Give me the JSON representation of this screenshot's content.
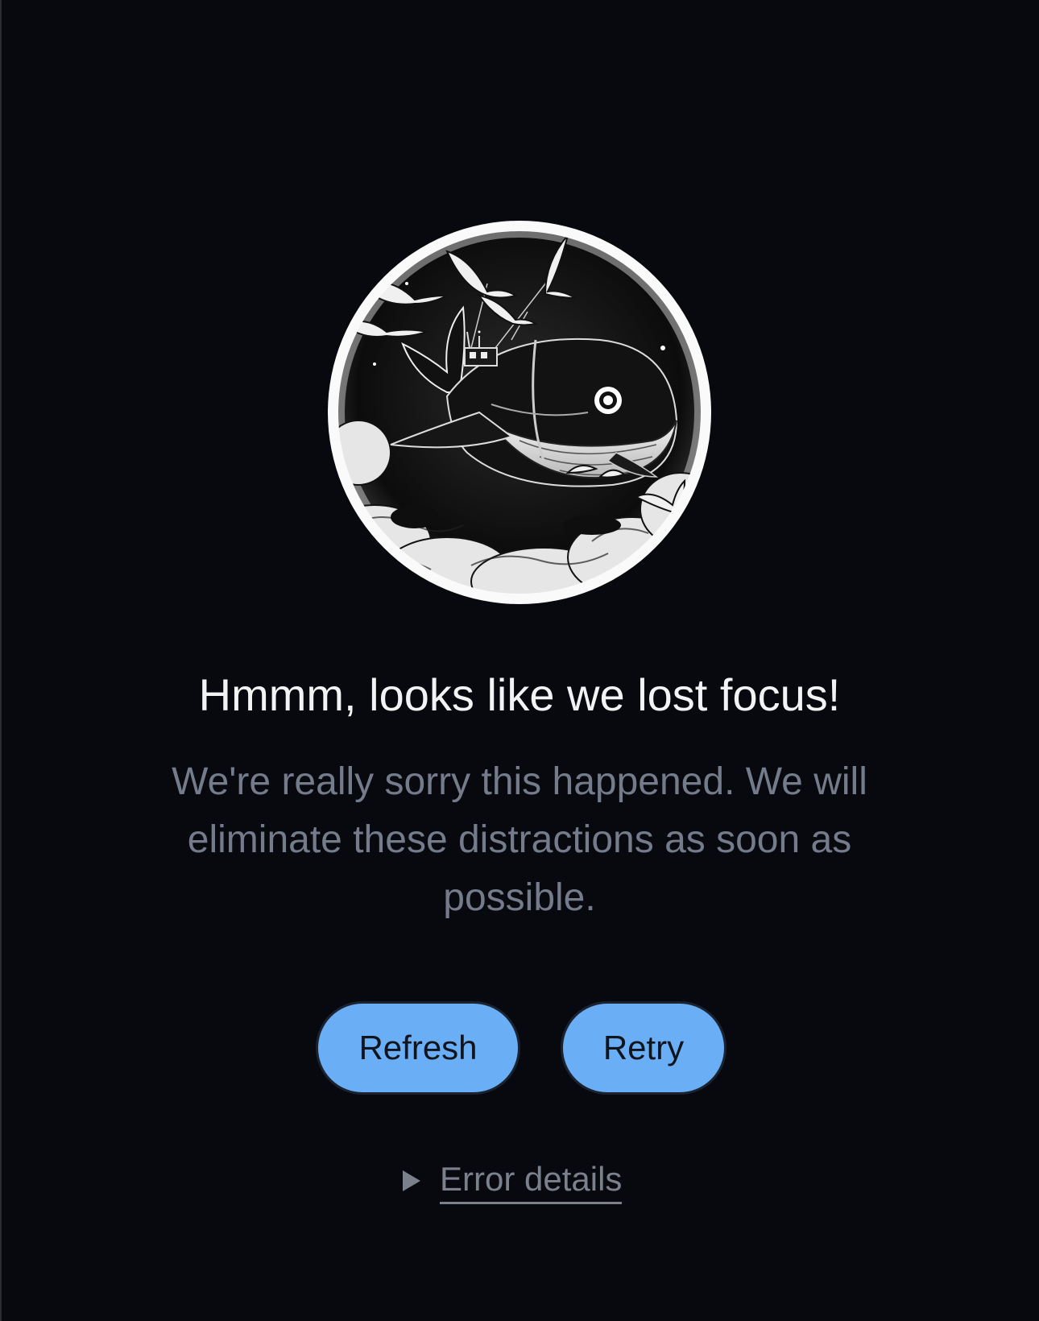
{
  "error_page": {
    "title": "Hmmm, looks like we lost focus!",
    "message": "We're really sorry this happened. We will eliminate these distractions as soon as possible.",
    "illustration": "flying-whale-illustration"
  },
  "actions": {
    "refresh_label": "Refresh",
    "retry_label": "Retry"
  },
  "details": {
    "label": "Error details",
    "expand_icon": "triangle-right-icon"
  },
  "colors": {
    "background": "#07090e",
    "title": "#f2f3f5",
    "message": "#747b8a",
    "button": "#6aaef6",
    "button_text": "#10141c"
  }
}
